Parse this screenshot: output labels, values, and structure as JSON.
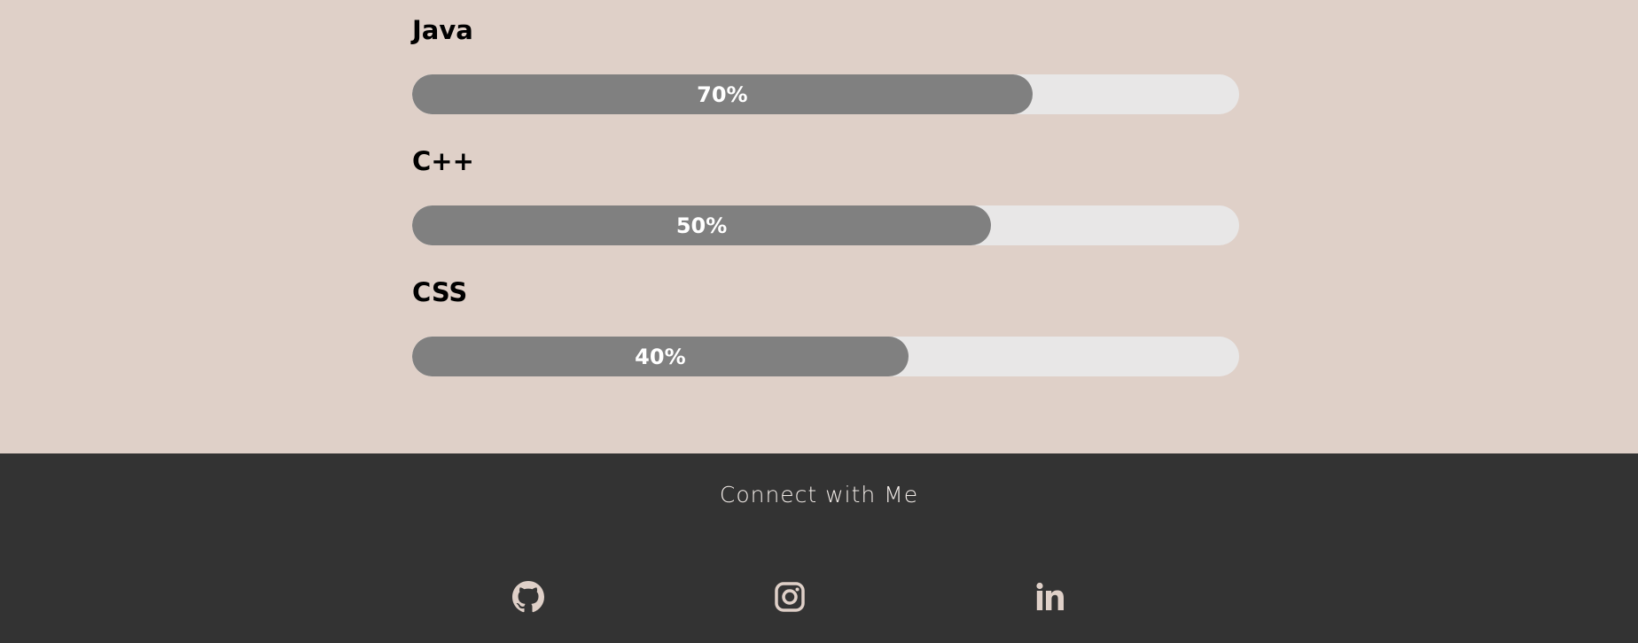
{
  "skills": [
    {
      "name": "Java",
      "level_text": "70%",
      "fill_fraction": 0.75
    },
    {
      "name": "C++",
      "level_text": "50%",
      "fill_fraction": 0.7
    },
    {
      "name": "CSS",
      "level_text": "40%",
      "fill_fraction": 0.6
    }
  ],
  "footer": {
    "heading": "Connect with Me",
    "links": [
      {
        "icon": "github-icon"
      },
      {
        "icon": "instagram-icon"
      },
      {
        "icon": "linkedin-icon"
      }
    ]
  },
  "colors": {
    "page_background": "#dfd0c8",
    "bar_track": "#e8e7e7",
    "bar_fill": "#808080",
    "footer_background": "#333333",
    "icon_color": "#dfd0c8"
  }
}
